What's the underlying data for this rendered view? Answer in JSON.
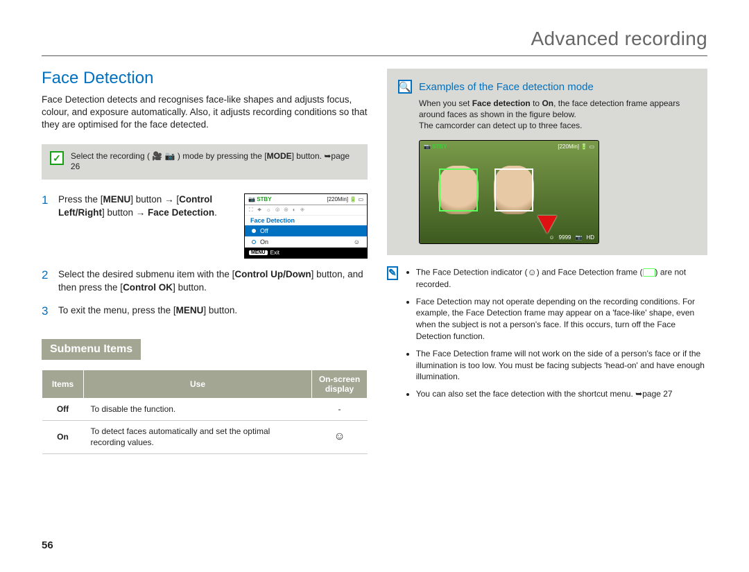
{
  "header": {
    "title": "Advanced recording"
  },
  "section": {
    "title": "Face Detection",
    "intro": "Face Detection detects and recognises face-like shapes and adjusts focus, colour, and exposure automatically. Also, it adjusts recording conditions so that they are optimised for the face detected."
  },
  "callout": {
    "text_pre": "Select the recording (",
    "text_post": ") mode by pressing the [",
    "mode": "MODE",
    "text_end": "] button. ",
    "page_ref": "page 26"
  },
  "steps": {
    "s1": {
      "num": "1",
      "a": "Press the [",
      "menu": "MENU",
      "b": "] button → [",
      "ctrl_lr": "Control Left/Right",
      "c": "] button → ",
      "fd": "Face Detection",
      "d": "."
    },
    "s2": {
      "num": "2",
      "a": "Select the desired submenu item with the [",
      "ctrl_ud": "Control Up/Down",
      "b": "] button, and then press the [",
      "ctrl_ok": "Control OK",
      "c": "] button."
    },
    "s3": {
      "num": "3",
      "a": "To exit the menu, press the [",
      "menu": "MENU",
      "b": "] button."
    }
  },
  "lcd": {
    "stby": "STBY",
    "time": "[220Min]",
    "menu_title": "Face Detection",
    "off": "Off",
    "on": "On",
    "exit": "Exit",
    "menu_btn": "MENU"
  },
  "submenu": {
    "heading": "Submenu Items",
    "th_items": "Items",
    "th_use": "Use",
    "th_display": "On-screen display",
    "rows": [
      {
        "item": "Off",
        "use": "To disable the function.",
        "disp": "-"
      },
      {
        "item": "On",
        "use": "To detect faces automatically and set the optimal recording values.",
        "disp": "icon"
      }
    ]
  },
  "panel": {
    "title": "Examples of the Face detection mode",
    "line1a": "When you set ",
    "fd": "Face detection",
    "line1b": " to ",
    "on": "On",
    "line1c": ", the face detection frame appears around faces as shown in the figure below.",
    "line2": "The camcorder can detect up to three faces."
  },
  "preview": {
    "stby": "STBY",
    "time": "[220Min]",
    "count": "9999",
    "hd": "HD"
  },
  "notes": {
    "n1a": "The Face Detection indicator (",
    "n1b": ") and Face Detection frame (",
    "n1c": ") are not recorded.",
    "n2": "Face Detection may not operate depending on the recording conditions. For example, the Face Detection frame may appear on a 'face-like' shape, even when the subject is not a person's face. If this occurs, turn off the Face Detection function.",
    "n3": "The Face Detection frame will not work on the side of a person's face or if the illumination is too low. You must be facing subjects 'head-on' and have enough illumination.",
    "n4": "You can also set the face detection with the shortcut menu. ",
    "n4_page": "page 27"
  },
  "page_number": "56"
}
